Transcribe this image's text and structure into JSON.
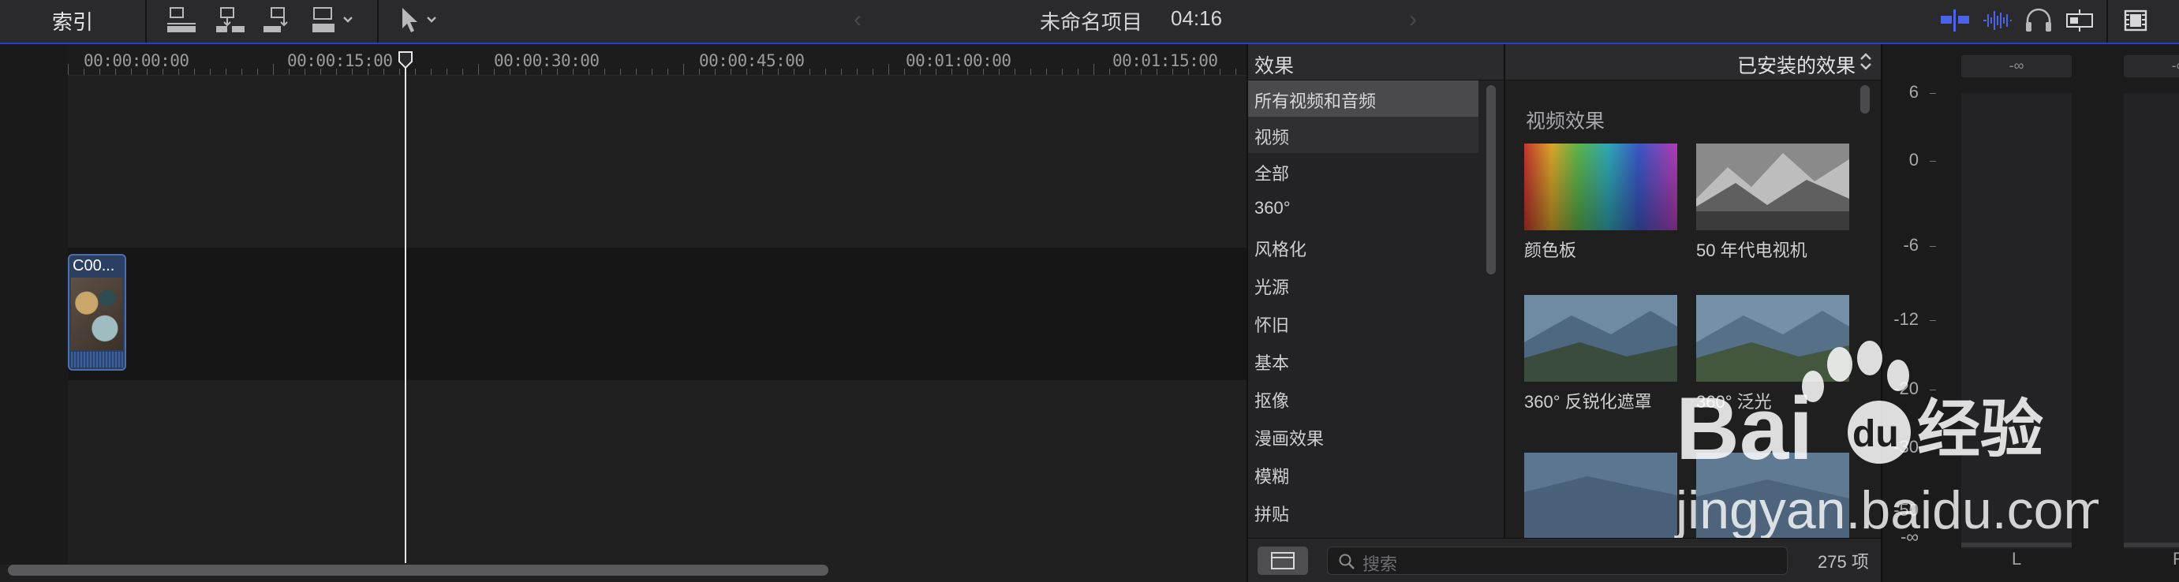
{
  "toolbar": {
    "index_label": "索引",
    "project_title": "未命名项目",
    "timecode": "04:16",
    "prev_arrow": "‹",
    "next_arrow": "›"
  },
  "timeline": {
    "ruler_labels": [
      "00:00:00:00",
      "00:00:15:00",
      "00:00:30:00",
      "00:00:45:00",
      "00:01:00:00",
      "00:01:15:00"
    ],
    "clip_name": "C00..."
  },
  "effects": {
    "panel_title": "效果",
    "categories": [
      {
        "label": "所有视频和音频",
        "state": "selected"
      },
      {
        "label": "视频",
        "state": "group"
      },
      {
        "label": "全部",
        "state": ""
      },
      {
        "label": "360°",
        "state": ""
      },
      {
        "label": "风格化",
        "state": ""
      },
      {
        "label": "光源",
        "state": ""
      },
      {
        "label": "怀旧",
        "state": ""
      },
      {
        "label": "基本",
        "state": ""
      },
      {
        "label": "抠像",
        "state": ""
      },
      {
        "label": "漫画效果",
        "state": ""
      },
      {
        "label": "模糊",
        "state": ""
      },
      {
        "label": "拼贴",
        "state": ""
      }
    ],
    "filter_label": "已安装的效果",
    "sort_icon": "chevron-updown-icon",
    "section_title": "视频效果",
    "items": [
      {
        "label": "颜色板"
      },
      {
        "label": "50 年代电视机"
      },
      {
        "label": "360° 反锐化遮罩"
      },
      {
        "label": "360° 泛光"
      },
      {
        "label": ""
      },
      {
        "label": ""
      }
    ],
    "search_placeholder": "搜索",
    "item_count": "275 项"
  },
  "meters": {
    "peak_left": "-∞",
    "peak_right": "-∞",
    "scale": [
      "6",
      "0",
      "-6",
      "-12",
      "-20",
      "-30",
      "-50",
      "-∞"
    ],
    "channel_left": "L",
    "channel_right": "R"
  },
  "watermark": {
    "text": "Baidu经验",
    "url": "jingyan.baidu.com"
  },
  "colors": {
    "accent": "#2c3bd6",
    "clip": "#2b3f63",
    "meter_active": "#4a63e8"
  }
}
